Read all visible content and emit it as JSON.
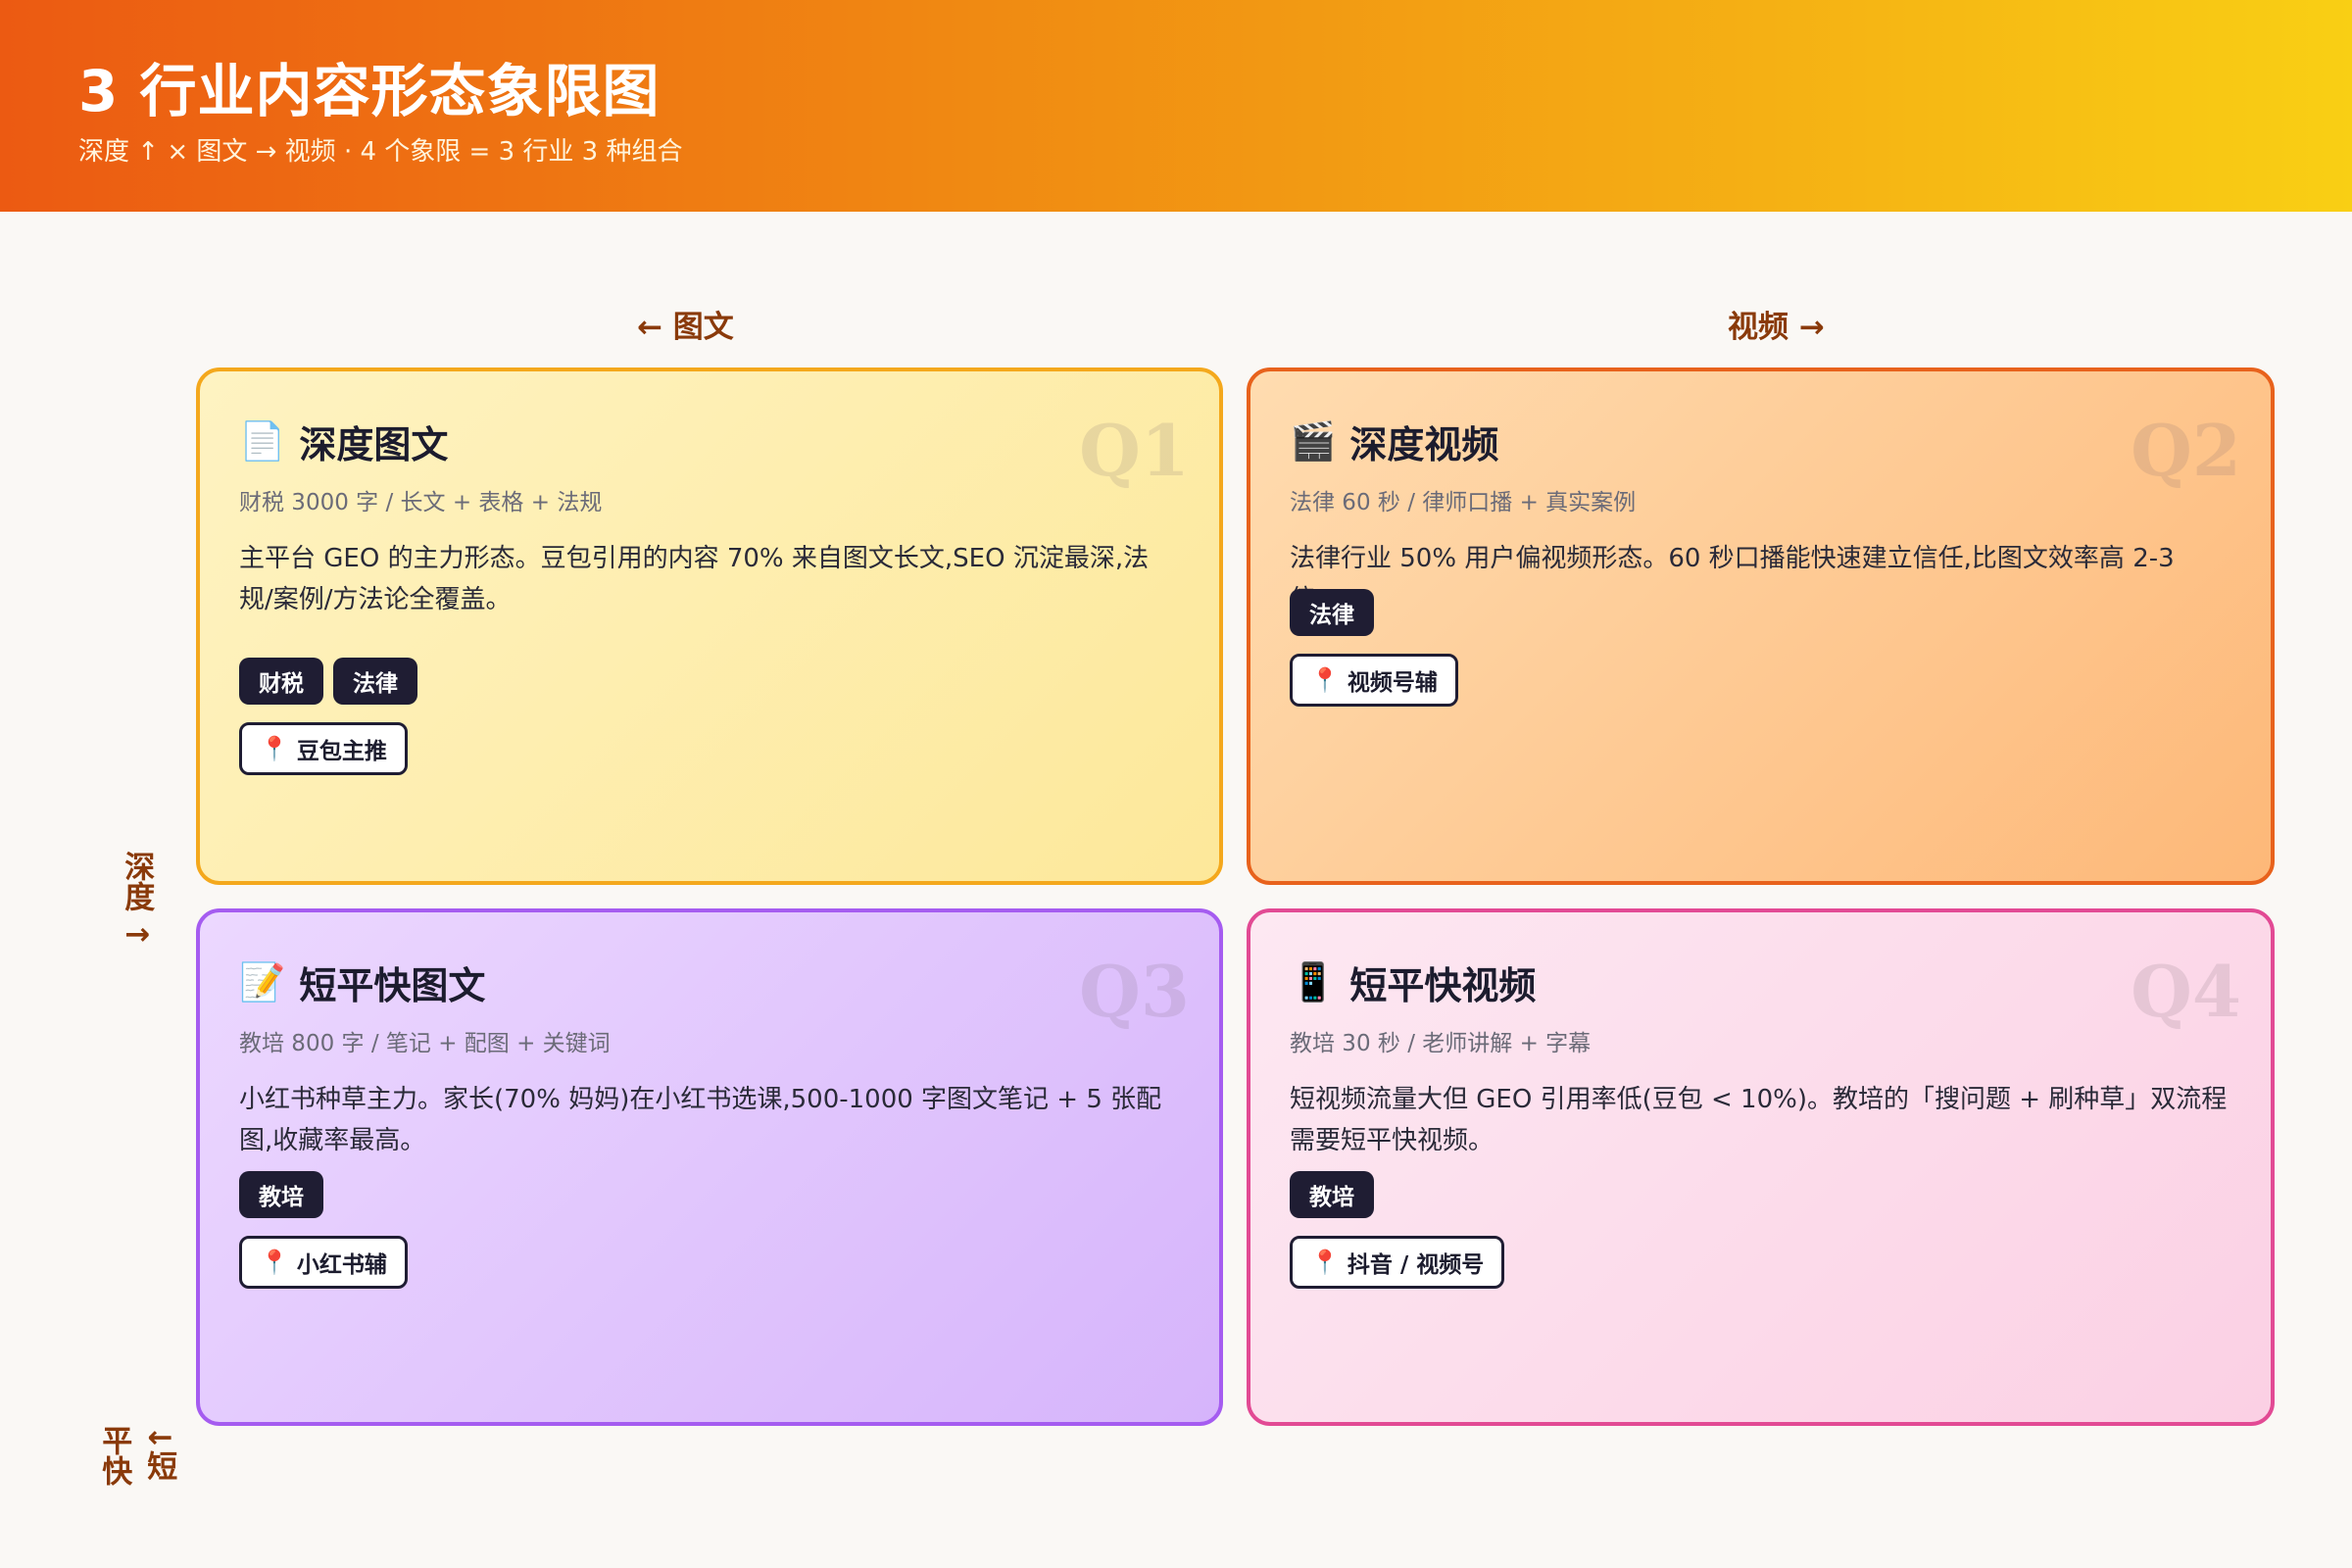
{
  "header": {
    "title": "3 行业内容形态象限图",
    "subtitle": "深度 ↑ × 图文 → 视频 · 4 个象限 = 3 行业 3 种组合"
  },
  "axes": {
    "left": "← 图文",
    "right": "视频 →",
    "deep": "深度 ↑",
    "short_col1": "平快",
    "short_col2": "↓短"
  },
  "quadrants": [
    {
      "tag": "Q1",
      "icon": "📄",
      "icon_name": "document-icon",
      "title": "深度图文",
      "meta": "财税 3000 字 / 长文 + 表格 + 法规",
      "desc": "主平台 GEO 的主力形态。豆包引用的内容 70% 来自图文长文,SEO 沉淀最深,法规/案例/方法论全覆盖。",
      "chips": [
        "财税",
        "法律"
      ],
      "platform": "豆包主推"
    },
    {
      "tag": "Q2",
      "icon": "🎬",
      "icon_name": "clapper-icon",
      "title": "深度视频",
      "meta": "法律 60 秒 / 律师口播 + 真实案例",
      "desc": "法律行业 50% 用户偏视频形态。60 秒口播能快速建立信任,比图文效率高 2-3 倍。",
      "chips": [
        "法律"
      ],
      "platform": "视频号辅"
    },
    {
      "tag": "Q3",
      "icon": "📝",
      "icon_name": "memo-icon",
      "title": "短平快图文",
      "meta": "教培 800 字 / 笔记 + 配图 + 关键词",
      "desc": "小红书种草主力。家长(70% 妈妈)在小红书选课,500-1000 字图文笔记 + 5 张配图,收藏率最高。",
      "chips": [
        "教培"
      ],
      "platform": "小红书辅"
    },
    {
      "tag": "Q4",
      "icon": "📱",
      "icon_name": "phone-icon",
      "title": "短平快视频",
      "meta": "教培 30 秒 / 老师讲解 + 字幕",
      "desc": "短视频流量大但 GEO 引用率低(豆包 < 10%)。教培的「搜问题 + 刷种草」双流程需要短平快视频。",
      "chips": [
        "教培"
      ],
      "platform": "抖音 / 视频号"
    }
  ],
  "pin_icon": "📍"
}
